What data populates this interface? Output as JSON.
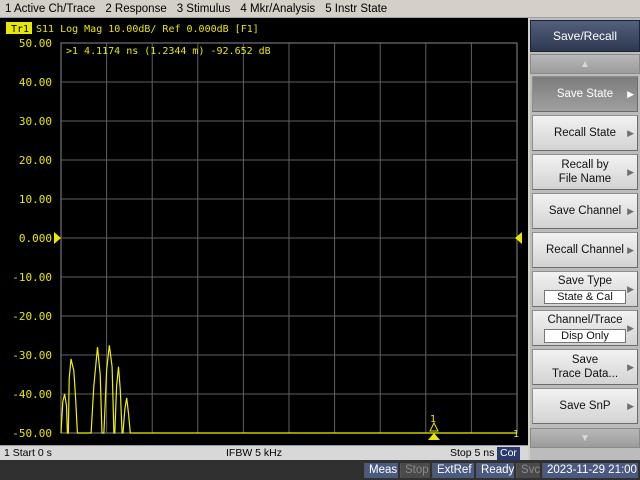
{
  "menu": [
    "1 Active Ch/Trace",
    "2 Response",
    "3 Stimulus",
    "4 Mkr/Analysis",
    "5 Instr State"
  ],
  "trace_header": {
    "trace_label": "Tr1",
    "text": "S11 Log Mag 10.00dB/ Ref 0.000dB [F1]"
  },
  "marker_readout": ">1  4.1174 ns (1.2344 m) -92.652 dB",
  "marker_label": "1",
  "channel_end_label": "1",
  "chart_data": {
    "type": "line",
    "ylabel": "",
    "ylim": [
      -50,
      50
    ],
    "y_ticks": [
      "50.00",
      "40.00",
      "30.00",
      "20.00",
      "10.00",
      "0.000",
      "-10.00",
      "-20.00",
      "-30.00",
      "-40.00",
      "-50.00"
    ],
    "x_range_ns": [
      0,
      5
    ],
    "grid": true,
    "reference_level": 0.0,
    "colors": {
      "trace": "#f0f000",
      "grid": "#606060",
      "background": "#000000"
    },
    "series": [
      {
        "points": [
          [
            0.0,
            -50
          ],
          [
            0.02,
            -42
          ],
          [
            0.04,
            -40
          ],
          [
            0.06,
            -43
          ],
          [
            0.07,
            -50
          ],
          [
            0.08,
            -50
          ],
          [
            0.09,
            -36
          ],
          [
            0.11,
            -31
          ],
          [
            0.14,
            -34
          ],
          [
            0.16,
            -41
          ],
          [
            0.18,
            -50
          ],
          [
            0.33,
            -50
          ],
          [
            0.36,
            -38
          ],
          [
            0.4,
            -28
          ],
          [
            0.43,
            -35
          ],
          [
            0.45,
            -50
          ],
          [
            0.47,
            -50
          ],
          [
            0.5,
            -34
          ],
          [
            0.53,
            -27.5
          ],
          [
            0.56,
            -33
          ],
          [
            0.58,
            -50
          ],
          [
            0.59,
            -50
          ],
          [
            0.61,
            -38
          ],
          [
            0.63,
            -33
          ],
          [
            0.65,
            -39
          ],
          [
            0.67,
            -50
          ],
          [
            0.68,
            -50
          ],
          [
            0.7,
            -44
          ],
          [
            0.72,
            -41
          ],
          [
            0.74,
            -45
          ],
          [
            0.76,
            -50
          ],
          [
            5.0,
            -50
          ]
        ]
      }
    ]
  },
  "softkeys": {
    "title": "Save/Recall",
    "items": [
      {
        "label": "Save State",
        "active": true
      },
      {
        "label": "Recall State"
      },
      {
        "label": "Recall by",
        "label2": "File Name"
      },
      {
        "label": "Save Channel"
      },
      {
        "label": "Recall Channel"
      },
      {
        "label": "Save Type",
        "value": "State & Cal"
      },
      {
        "label": "Channel/Trace",
        "value": "Disp Only"
      },
      {
        "label": "Save",
        "label2": "Trace Data..."
      },
      {
        "label": "Save SnP"
      }
    ]
  },
  "infobar": {
    "start": "1  Start 0 s",
    "ifbw": "IFBW 5 kHz",
    "stop": "Stop 5 ns",
    "cor": "Cor"
  },
  "status": {
    "meas": "Meas",
    "stop": "Stop",
    "extref": "ExtRef",
    "ready": "Ready",
    "svc": "Svc",
    "datetime": "2023-11-29 21:00"
  }
}
